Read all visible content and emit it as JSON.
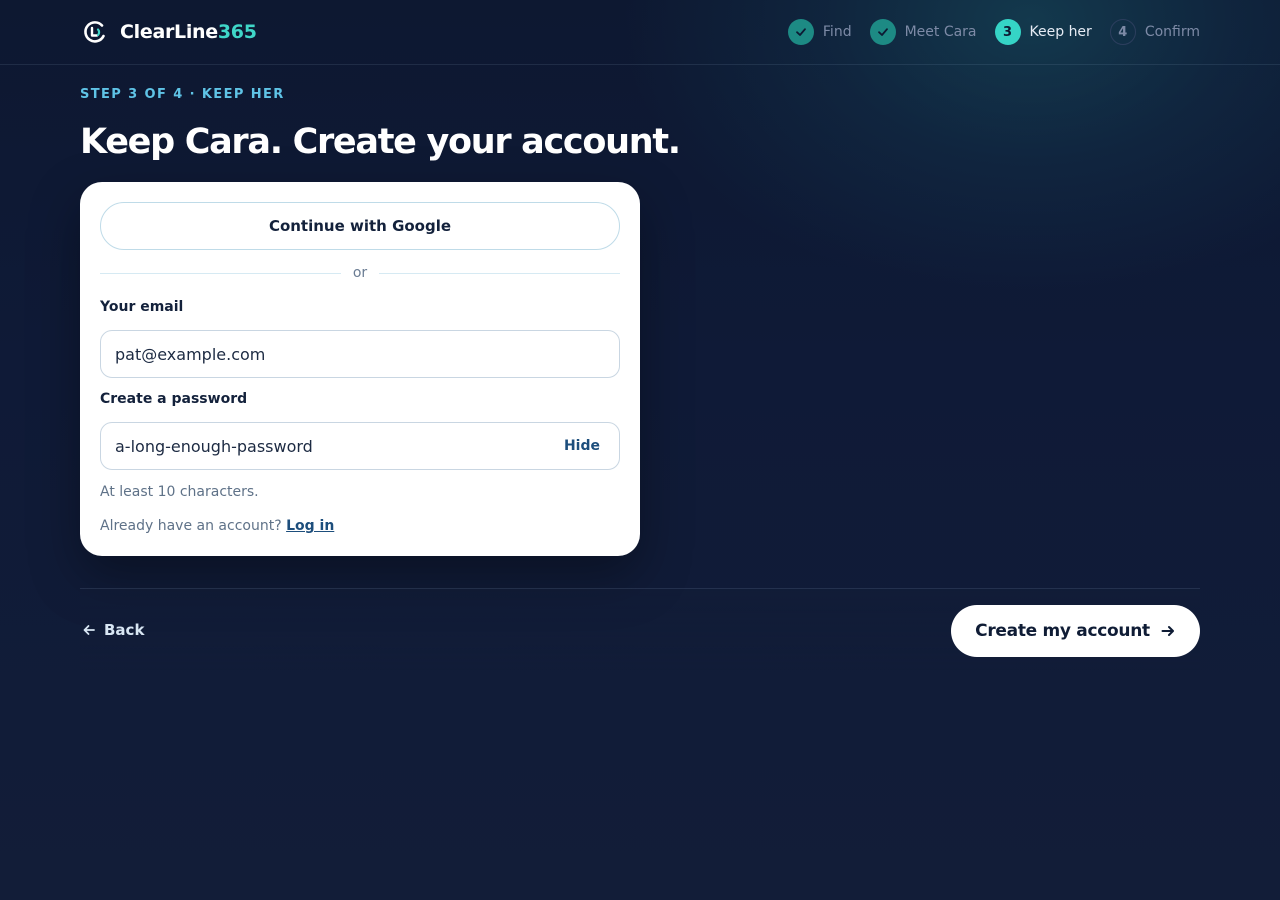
{
  "brand": {
    "name": "ClearLine",
    "number": "365"
  },
  "stepper": {
    "steps": [
      {
        "label": "Find",
        "number": "1",
        "state": "done"
      },
      {
        "label": "Meet Cara",
        "number": "2",
        "state": "done"
      },
      {
        "label": "Keep her",
        "number": "3",
        "state": "current"
      },
      {
        "label": "Confirm",
        "number": "4",
        "state": "todo"
      }
    ]
  },
  "main": {
    "eyebrow": "STEP 3 OF 4 · KEEP HER",
    "title": "Keep Cara. Create your account."
  },
  "form": {
    "google_label": "Continue with Google",
    "divider_text": "or",
    "email_label": "Your email",
    "email_value": "pat@example.com",
    "password_label": "Create a password",
    "password_value": "a-long-enough-password",
    "hide_label": "Hide",
    "password_hint": "At least 10 characters.",
    "login_prompt": "Already have an account?",
    "login_link": "Log in"
  },
  "footer": {
    "back_label": "Back",
    "cta_label": "Create my account"
  },
  "colors": {
    "background": "#121c36",
    "accent_teal": "#35d4c6",
    "done_teal": "#1d8a84",
    "eyebrow_blue": "#5fc3e6",
    "link_blue": "#1d4e7c"
  },
  "icons": {
    "logo": "clearline-logo-icon",
    "done": "check-icon",
    "back": "arrow-left-icon",
    "cta": "arrow-right-icon"
  }
}
